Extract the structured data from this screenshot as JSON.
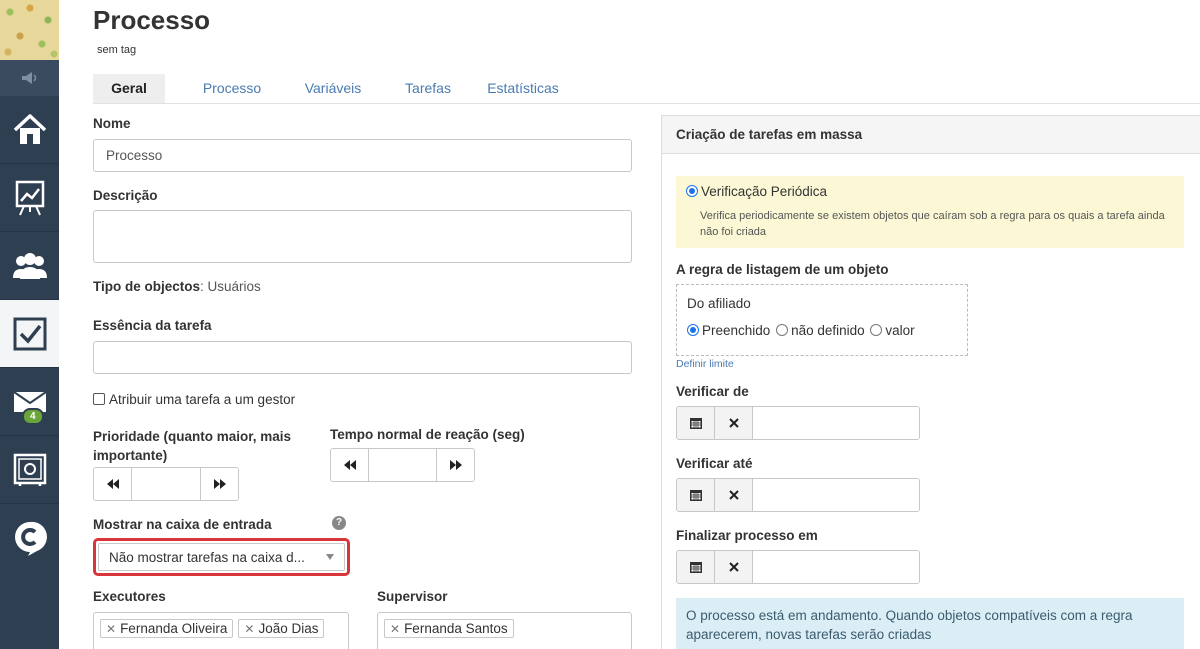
{
  "app": {
    "title": "Processo",
    "tag_label": "sem tag"
  },
  "sidebar": {
    "mail_badge": "4"
  },
  "tabs": [
    {
      "label": "Geral",
      "active": true
    },
    {
      "label": "Processo"
    },
    {
      "label": "Variáveis"
    },
    {
      "label": "Tarefas"
    },
    {
      "label": "Estatísticas"
    }
  ],
  "form": {
    "name_label": "Nome",
    "name_value": "Processo",
    "description_label": "Descrição",
    "object_type_label": "Tipo de objectos",
    "object_type_value": ": Usuários",
    "essence_label": "Essência da tarefa",
    "assign_manager_label": "Atribuir uma tarefa a um gestor",
    "priority_label": "Prioridade (quanto maior, mais importante)",
    "reaction_time_label": "Tempo normal de reação (seg)",
    "inbox_label": "Mostrar na caixa de entrada",
    "inbox_value": "Não mostrar tarefas na caixa d...",
    "executors_label": "Executores",
    "executors": [
      "Fernanda Oliveira",
      "João Dias"
    ],
    "supervisor_label": "Supervisor",
    "supervisors": [
      "Fernanda Santos"
    ]
  },
  "panel": {
    "title": "Criação de tarefas em massa",
    "periodic_label": "Verificação Periódica",
    "periodic_desc": "Verifica periodicamente se existem objetos que caíram sob a regra para os quais a tarefa ainda não foi criada",
    "rule_title": "A regra de listagem de um objeto",
    "rule_field": "Do afiliado",
    "rule_opt_filled": "Preenchido",
    "rule_opt_undefined": "não definido",
    "rule_opt_value": "valor",
    "limit_link": "Definir limite",
    "check_from_label": "Verificar de",
    "check_until_label": "Verificar até",
    "finish_label": "Finalizar processo em",
    "info_text": "O processo está em andamento. Quando objetos compatíveis com a regra aparecerem, novas tarefas serão criadas"
  },
  "colors": {
    "sidebar_bg": "#2f3f52",
    "link": "#4a7bb0",
    "highlight_border": "#d9353b",
    "info_bg": "#dbeef6",
    "yellow_bg": "#fcf8d6"
  }
}
